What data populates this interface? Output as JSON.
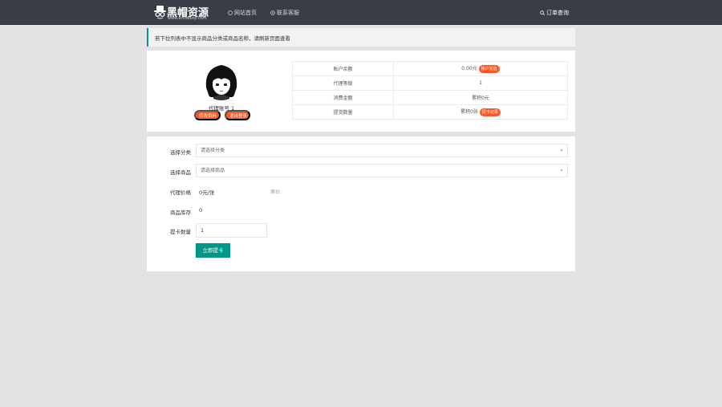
{
  "header": {
    "logo_title": "黑帽资源",
    "logo_subtitle": "www.antiadzip.com",
    "nav": {
      "home": "网站首页",
      "contact": "联系客服",
      "order_query": "订单查询"
    }
  },
  "notice": "若下拉列表中不显示商品分类或商品名称，请刷新页面查看",
  "profile": {
    "nickname": "代理账号 1",
    "edit_button": "修改资料",
    "logout_button": "退出登录",
    "rows": [
      {
        "key": "账户余额",
        "value": "0.00元",
        "badge": "账户充值"
      },
      {
        "key": "代理等级",
        "value": "1",
        "badge": ""
      },
      {
        "key": "消费金额",
        "value": "累积0元",
        "badge": ""
      },
      {
        "key": "提货数量",
        "value": "累积0张",
        "badge": "提卡记录"
      }
    ]
  },
  "form": {
    "category_label": "选择分类",
    "category_placeholder": "请选择分类",
    "product_label": "选择商品",
    "product_placeholder": "请选择商品",
    "price_label": "代理价格",
    "price_value": "0元/张",
    "price_note": "原价:",
    "stock_label": "商品库存",
    "stock_value": "0",
    "qty_label": "提卡数量",
    "qty_value": "1",
    "submit_button": "立即提卡"
  },
  "colors": {
    "topbar": "#3b3d46",
    "accent_green": "#009688",
    "accent_orange": "#ff5722"
  }
}
